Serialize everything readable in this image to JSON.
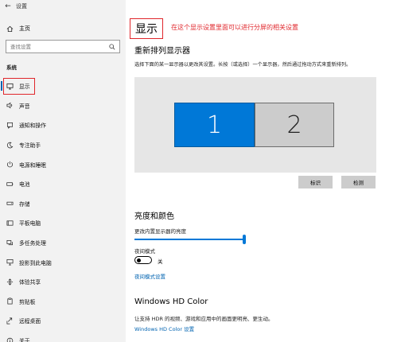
{
  "window": {
    "title": "设置",
    "back_glyph": "←"
  },
  "sidebar": {
    "home_label": "主页",
    "search_placeholder": "查找设置",
    "group_label": "系统",
    "items": [
      {
        "label": "显示",
        "icon": "monitor-icon"
      },
      {
        "label": "声音",
        "icon": "speaker-icon"
      },
      {
        "label": "通知和操作",
        "icon": "notification-icon"
      },
      {
        "label": "专注助手",
        "icon": "moon-icon"
      },
      {
        "label": "电源和睡眠",
        "icon": "power-icon"
      },
      {
        "label": "电池",
        "icon": "battery-icon"
      },
      {
        "label": "存储",
        "icon": "storage-icon"
      },
      {
        "label": "平板电脑",
        "icon": "tablet-icon"
      },
      {
        "label": "多任务处理",
        "icon": "multitask-icon"
      },
      {
        "label": "投影到此电脑",
        "icon": "project-icon"
      },
      {
        "label": "体验共享",
        "icon": "share-icon"
      },
      {
        "label": "剪贴板",
        "icon": "clipboard-icon"
      },
      {
        "label": "远程桌面",
        "icon": "remote-icon"
      },
      {
        "label": "关于",
        "icon": "info-icon"
      }
    ]
  },
  "main": {
    "title": "显示",
    "annotation": "在这个显示设置里面可以进行分屏的相关设置",
    "rearrange": {
      "heading": "重新排列显示器",
      "description": "选择下面的某一显示器以更改其设置。长按（或选择）一个显示器，然后通过拖动方式来重新排列。",
      "monitors": [
        "1",
        "2"
      ],
      "identify_label": "标识",
      "detect_label": "检测"
    },
    "brightness": {
      "heading": "亮度和颜色",
      "slider_label": "更改内置显示器的亮度",
      "value_fraction": 1.0,
      "night_light_label": "夜间模式",
      "night_light_state": "关",
      "night_light_link": "夜间模式设置"
    },
    "hdr": {
      "heading": "Windows HD Color",
      "description": "让支持 HDR 的视频、游戏和应用中的画面更明亮、更生动。",
      "link": "Windows HD Color 设置"
    }
  },
  "colors": {
    "accent": "#0078d7",
    "highlight_box": "#e0262b",
    "sidebar_bg": "#f2f2f2",
    "monitor_area": "#e6e6e6"
  }
}
